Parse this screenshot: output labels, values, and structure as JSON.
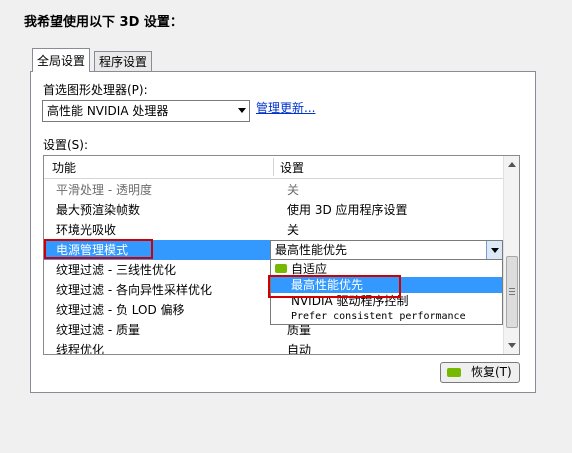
{
  "heading": "我希望使用以下 3D 设置：",
  "tabs": [
    {
      "label": "全局设置"
    },
    {
      "label": "程序设置"
    }
  ],
  "processor": {
    "label": "首选图形处理器(P):",
    "value": "高性能 NVIDIA 处理器",
    "manage_link": "管理更新..."
  },
  "settings_label": "设置(S):",
  "columns": {
    "feature": "功能",
    "setting": "设置"
  },
  "rows": [
    {
      "feature": "平滑处理 - 透明度",
      "setting": "关"
    },
    {
      "feature": "最大预渲染帧数",
      "setting": "使用 3D 应用程序设置"
    },
    {
      "feature": "环境光吸收",
      "setting": "关"
    },
    {
      "feature": "电源管理模式",
      "setting": ""
    },
    {
      "feature": "纹理过滤 - 三线性优化",
      "setting": ""
    },
    {
      "feature": "纹理过滤 - 各向异性采样优化",
      "setting": ""
    },
    {
      "feature": "纹理过滤 - 负 LOD 偏移",
      "setting": ""
    },
    {
      "feature": "纹理过滤 - 质量",
      "setting": "质量"
    },
    {
      "feature": "线程优化",
      "setting": "自动"
    }
  ],
  "power_combo": {
    "value": "最高性能优先",
    "options": [
      {
        "label": "自适应",
        "icon": "nvidia-icon"
      },
      {
        "label": "最高性能优先"
      },
      {
        "label": "NVIDIA 驱动程序控制"
      },
      {
        "label": "Prefer consistent performance"
      }
    ]
  },
  "restore_button": "恢复(T)",
  "colors": {
    "selection": "#3399ff",
    "highlight_box": "#d00000",
    "nvidia_green": "#76b900"
  }
}
